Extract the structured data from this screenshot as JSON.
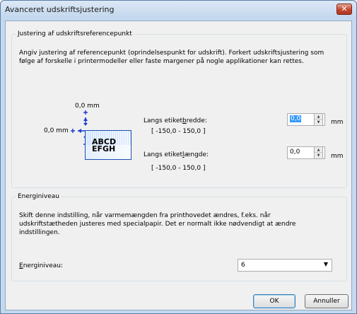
{
  "window": {
    "title": "Avanceret udskriftsjustering",
    "close_glyph": "✕"
  },
  "alignment": {
    "group_label": "Justering af udskriftsreferencepunkt",
    "description_line1": "Angiv justering af referencepunkt (oprindelsespunkt for udskrift). Forkert udskriftsjustering som",
    "description_line2": "følge af forskelle i printermodeller eller faste margener på nogle applikationer kan rettes.",
    "top_offset_label": "0,0 mm",
    "left_offset_label": "0,0 mm",
    "sample_text_line1": "ABCD",
    "sample_text_line2": "EFGH",
    "width": {
      "label_pre": "Langs etiket",
      "label_accel": "b",
      "label_post": "redde:",
      "value": "0,0",
      "range": "[ -150,0 - 150,0 ]",
      "unit": "mm"
    },
    "length": {
      "label_pre": "Langs etiket",
      "label_accel": "l",
      "label_post": "ængde:",
      "value": "0,0",
      "range": "[ -150,0 - 150,0 ]",
      "unit": "mm"
    }
  },
  "energy": {
    "group_label": "Energiniveau",
    "description_line1": "Skift denne indstilling, når varmemængden fra printhovedet ændres, f.eks. når",
    "description_line2": "udskriftstætheden justeres med specialpapir. Det er normalt ikke nødvendigt at ændre",
    "description_line3": "indstillingen.",
    "field_accel": "E",
    "field_label_post": "nerginiveau:",
    "selected_value": "6"
  },
  "buttons": {
    "ok": "OK",
    "cancel": "Annuller"
  }
}
